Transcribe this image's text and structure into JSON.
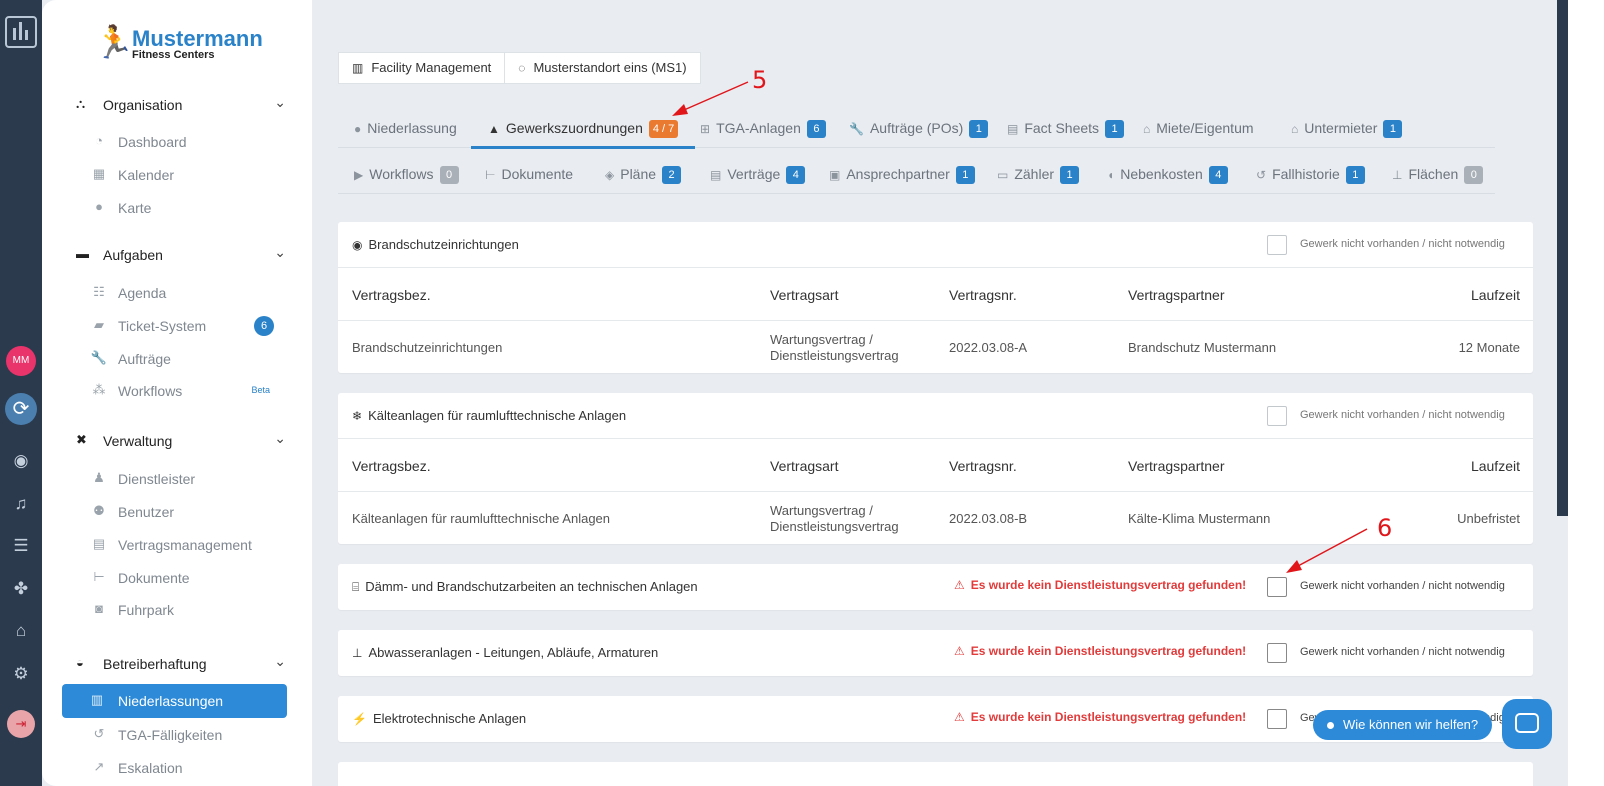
{
  "colors": {
    "primary": "#2a82c9",
    "sidebar_rail": "#2b3a4d",
    "warning": "#e23b3b",
    "badge_orange": "#ea7a2f",
    "avatar": "#e8336b"
  },
  "rail": {
    "avatar_initials": "MM",
    "icons": [
      "app-logo-icon",
      "sync-icon",
      "eye-icon",
      "bell-icon",
      "list-icon",
      "puzzle-icon",
      "store-icon",
      "gear-icon",
      "logout-icon"
    ]
  },
  "brand": {
    "name": "Mustermann",
    "subtitle": "Fitness Centers"
  },
  "sidebar": {
    "groups": [
      {
        "label": "Organisation",
        "icon": "sitemap-icon",
        "items": [
          {
            "label": "Dashboard",
            "icon": "gauge-icon"
          },
          {
            "label": "Kalender",
            "icon": "calendar-icon"
          },
          {
            "label": "Karte",
            "icon": "map-pin-icon"
          }
        ]
      },
      {
        "label": "Aufgaben",
        "icon": "toggle-icon",
        "items": [
          {
            "label": "Agenda",
            "icon": "list-check-icon"
          },
          {
            "label": "Ticket-System",
            "icon": "tickets-icon",
            "count": "6"
          },
          {
            "label": "Aufträge",
            "icon": "wrench-icon"
          },
          {
            "label": "Workflows",
            "icon": "nodes-icon",
            "tag": "Beta"
          }
        ]
      },
      {
        "label": "Verwaltung",
        "icon": "tools-icon",
        "items": [
          {
            "label": "Dienstleister",
            "icon": "person-icon"
          },
          {
            "label": "Benutzer",
            "icon": "users-icon"
          },
          {
            "label": "Vertragsmanagement",
            "icon": "file-icon"
          },
          {
            "label": "Dokumente",
            "icon": "folder-tree-icon"
          },
          {
            "label": "Fuhrpark",
            "icon": "car-icon"
          }
        ]
      },
      {
        "label": "Betreiberhaftung",
        "icon": "helmet-icon",
        "items": [
          {
            "label": "Niederlassungen",
            "icon": "building-icon",
            "active": true
          },
          {
            "label": "TGA-Fälligkeiten",
            "icon": "history-icon"
          },
          {
            "label": "Eskalation",
            "icon": "escalation-icon"
          }
        ]
      }
    ]
  },
  "breadcrumb": {
    "facility": "Facility Management",
    "location": "Musterstandort eins (MS1)"
  },
  "tabs_row1": [
    {
      "label": "Niederlassung",
      "icon": "map-pin-icon"
    },
    {
      "label": "Gewerkszuordnungen",
      "icon": "shapes-icon",
      "badge": "4 / 7",
      "active": true
    },
    {
      "label": "TGA-Anlagen",
      "icon": "tree-icon",
      "badge": "6"
    },
    {
      "label": "Aufträge (POs)",
      "icon": "wrench-icon",
      "badge": "1"
    },
    {
      "label": "Fact Sheets",
      "icon": "document-icon",
      "badge": "1"
    },
    {
      "label": "Miete/Eigentum",
      "icon": "home-icon"
    },
    {
      "label": "Untermieter",
      "icon": "home-icon",
      "badge": "1"
    }
  ],
  "tabs_row2": [
    {
      "label": "Workflows",
      "icon": "play-icon",
      "badge": "0"
    },
    {
      "label": "Dokumente",
      "icon": "tree-icon"
    },
    {
      "label": "Pläne",
      "icon": "layers-icon",
      "badge": "2"
    },
    {
      "label": "Verträge",
      "icon": "document-icon",
      "badge": "4"
    },
    {
      "label": "Ansprechpartner",
      "icon": "contact-card-icon",
      "badge": "1"
    },
    {
      "label": "Zähler",
      "icon": "keyboard-icon",
      "badge": "1"
    },
    {
      "label": "Nebenkosten",
      "icon": "piggy-bank-icon",
      "badge": "4"
    },
    {
      "label": "Fallhistorie",
      "icon": "history-icon",
      "badge": "1"
    },
    {
      "label": "Flächen",
      "icon": "stamp-icon",
      "badge": "0"
    }
  ],
  "table_headers": {
    "name": "Vertragsbez.",
    "type": "Vertragsart",
    "number": "Vertragsnr.",
    "partner": "Vertragspartner",
    "term": "Laufzeit"
  },
  "checkbox_label": "Gewerk nicht vorhanden / nicht notwendig",
  "warning_text": "Es wurde kein Dienstleistungsvertrag gefunden!",
  "cards": [
    {
      "title": "Brandschutzeinrichtungen",
      "icon": "fire-icon",
      "row": {
        "name": "Brandschutzeinrichtungen",
        "type_line1": "Wartungsvertrag /",
        "type_line2": "Dienstleistungsvertrag",
        "number": "2022.03.08-A",
        "partner": "Brandschutz Mustermann",
        "term": "12 Monate"
      }
    },
    {
      "title": "Kälteanlagen für raumlufttechnische Anlagen",
      "icon": "snowflake-icon",
      "row": {
        "name": "Kälteanlagen für raumlufttechnische Anlagen",
        "type_line1": "Wartungsvertrag /",
        "type_line2": "Dienstleistungsvertrag",
        "number": "2022.03.08-B",
        "partner": "Kälte-Klima Mustermann",
        "term": "Unbefristet"
      }
    },
    {
      "title": "Dämm- und Brandschutzarbeiten an technischen Anlagen",
      "icon": "fireplace-icon"
    },
    {
      "title": "Abwasseranlagen - Leitungen, Abläufe, Armaturen",
      "icon": "sink-icon"
    },
    {
      "title": "Elektrotechnische Anlagen",
      "icon": "bolt-icon"
    }
  ],
  "chat": {
    "label": "Wie können wir helfen?"
  },
  "annotations": {
    "a5": "5",
    "a6": "6"
  }
}
